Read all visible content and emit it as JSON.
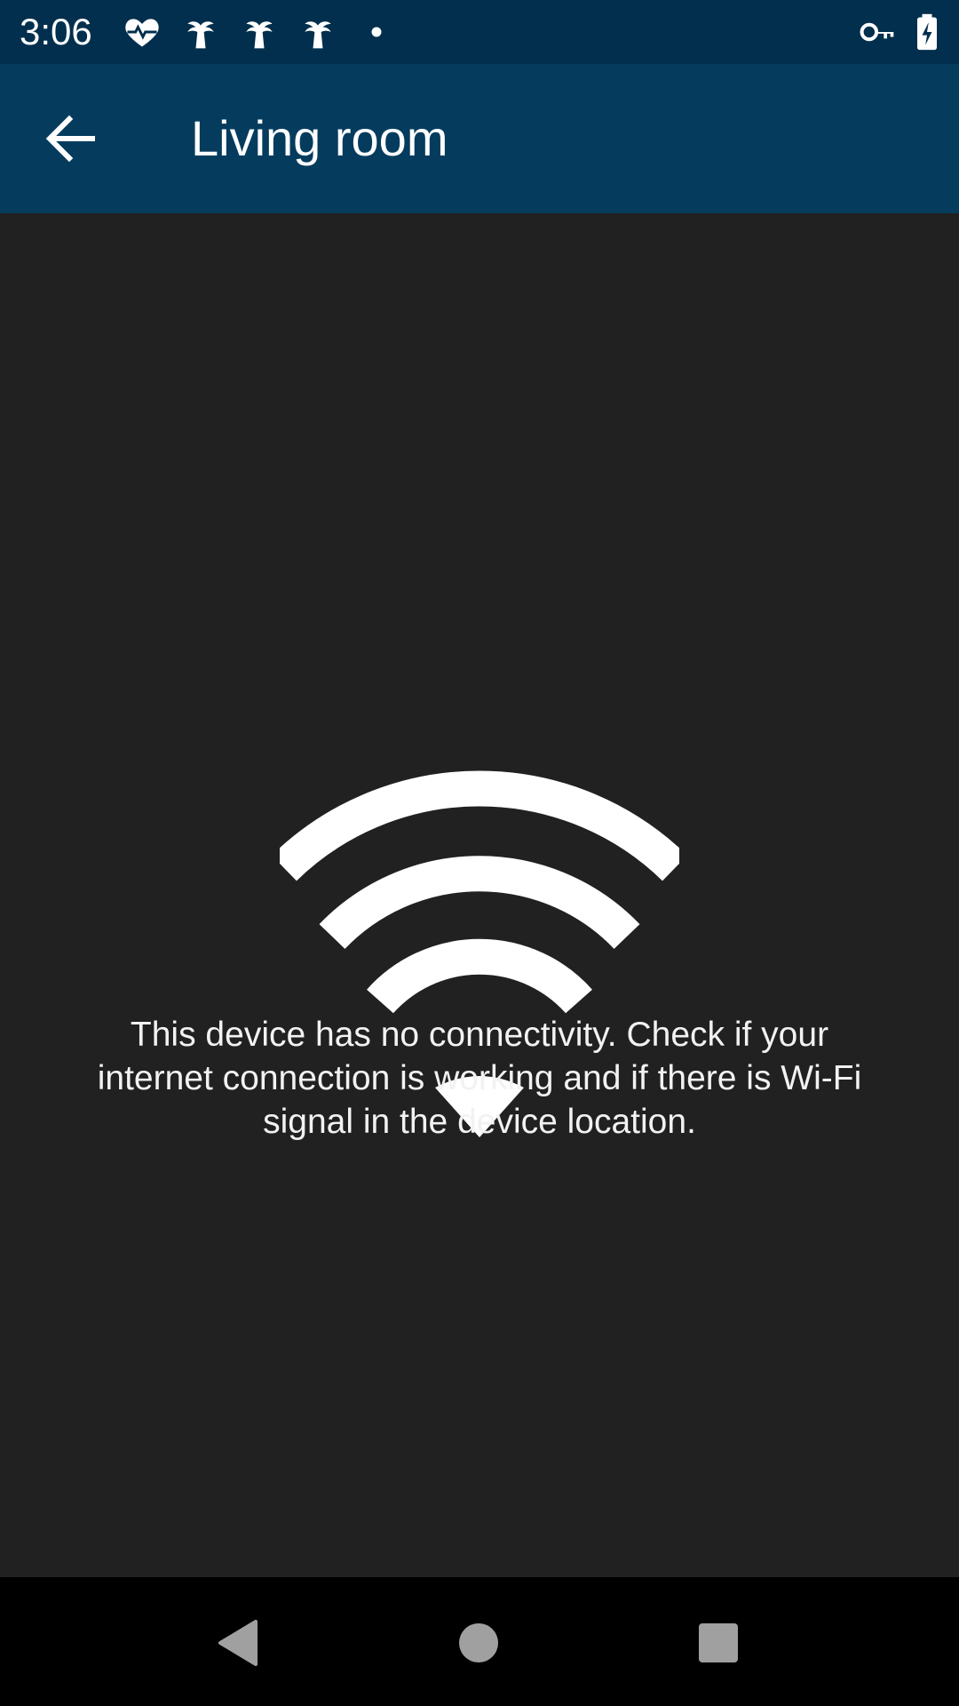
{
  "status_bar": {
    "time": "3:06",
    "icons": [
      "heart-pulse-icon",
      "palm-tree-icon",
      "palm-tree-icon",
      "palm-tree-icon",
      "dot-icon",
      "vpn-key-icon",
      "battery-charging-icon"
    ],
    "background": "#022f4d"
  },
  "app_bar": {
    "title": "Living room",
    "back_icon": "arrow-back-icon",
    "background": "#053c5e"
  },
  "content": {
    "illustration_icon": "wifi-icon",
    "message": "This device has no connectivity. Check if your internet connection is working and if there is Wi-Fi signal in the device location.",
    "background": "#212121"
  },
  "nav_bar": {
    "buttons": [
      "back-triangle-icon",
      "home-circle-icon",
      "recents-square-icon"
    ],
    "background": "#000000"
  }
}
